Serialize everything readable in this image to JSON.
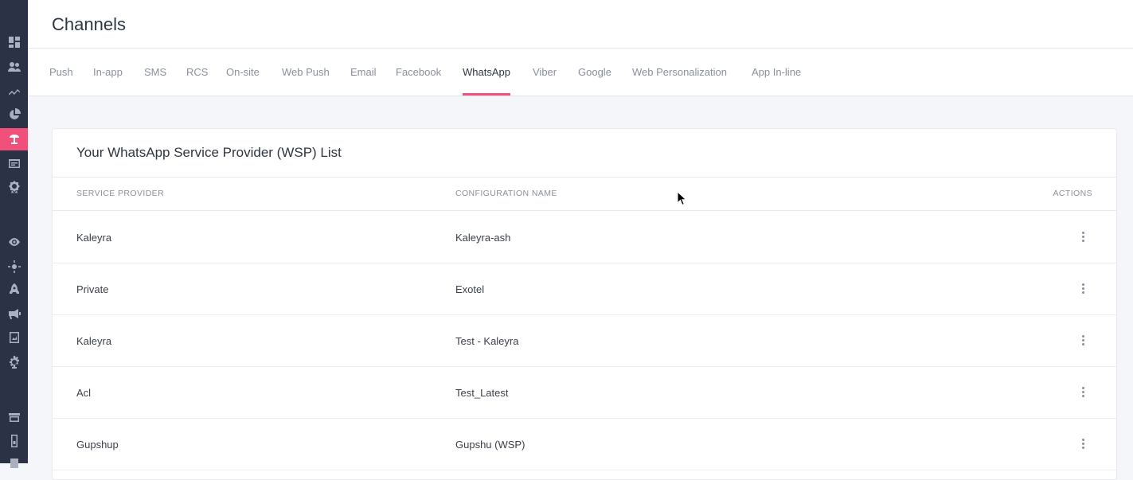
{
  "sidebar": {
    "items": [
      {
        "icon": "dashboard-icon",
        "active": false
      },
      {
        "icon": "users-icon",
        "active": false
      },
      {
        "icon": "trend-icon",
        "active": false
      },
      {
        "icon": "pie-chart-icon",
        "active": false
      },
      {
        "icon": "channels-icon",
        "active": true
      },
      {
        "icon": "inbox-icon",
        "active": false
      },
      {
        "icon": "badge-icon",
        "active": false
      },
      {
        "icon": "eye-icon",
        "active": false
      },
      {
        "icon": "settings-sun-icon",
        "active": false
      },
      {
        "icon": "rocket-icon",
        "active": false
      },
      {
        "icon": "megaphone-icon",
        "active": false
      },
      {
        "icon": "report-icon",
        "active": false
      },
      {
        "icon": "gear-icon",
        "active": false
      },
      {
        "icon": "store-icon",
        "active": false
      },
      {
        "icon": "device-icon",
        "active": false
      }
    ]
  },
  "header": {
    "title": "Channels"
  },
  "tabs": [
    {
      "label": "Push"
    },
    {
      "label": "In-app"
    },
    {
      "label": "SMS"
    },
    {
      "label": "RCS"
    },
    {
      "label": "On-site"
    },
    {
      "label": "Web Push"
    },
    {
      "label": "Email"
    },
    {
      "label": "Facebook"
    },
    {
      "label": "WhatsApp",
      "active": true
    },
    {
      "label": "Viber"
    },
    {
      "label": "Google"
    },
    {
      "label": "Web Personalization"
    },
    {
      "label": "App In-line"
    }
  ],
  "card": {
    "title": "Your WhatsApp Service Provider (WSP) List",
    "columns": {
      "provider": "SERVICE PROVIDER",
      "config": "CONFIGURATION NAME",
      "actions": "ACTIONS"
    },
    "rows": [
      {
        "provider": "Kaleyra",
        "config": "Kaleyra-ash"
      },
      {
        "provider": "Private",
        "config": "Exotel"
      },
      {
        "provider": "Kaleyra",
        "config": "Test - Kaleyra"
      },
      {
        "provider": "Acl",
        "config": "Test_Latest"
      },
      {
        "provider": "Gupshup",
        "config": "Gupshu (WSP)"
      }
    ]
  },
  "colors": {
    "accent": "#f0507a",
    "sidebar": "#2b3245"
  }
}
